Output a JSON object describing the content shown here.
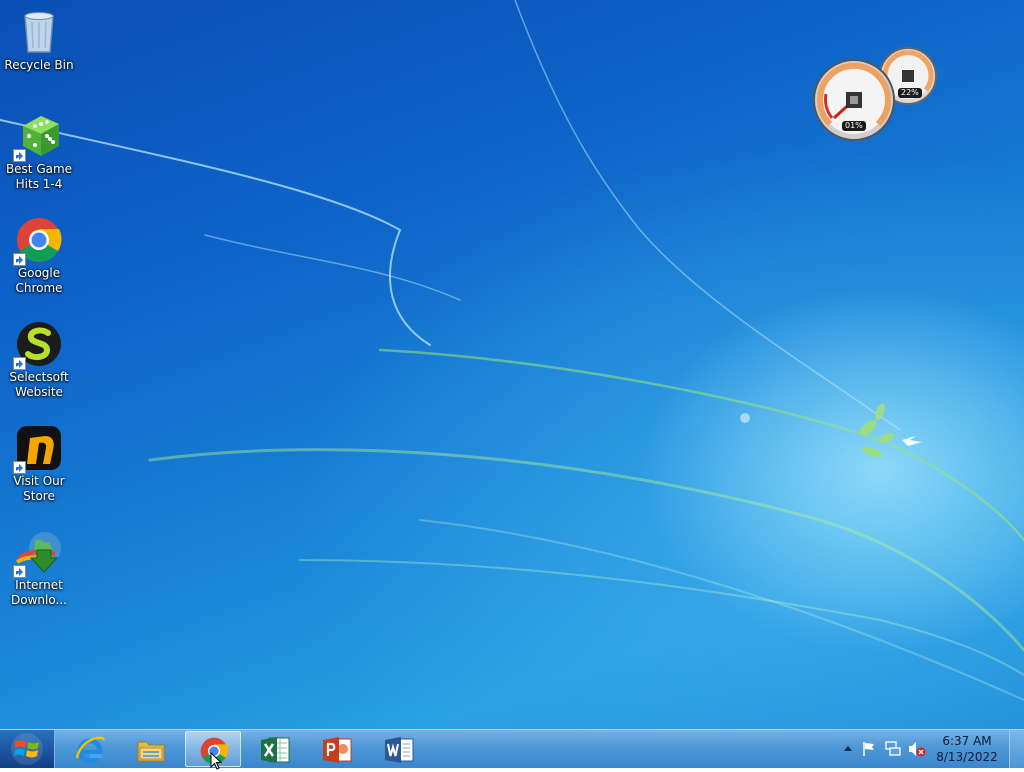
{
  "desktop": {
    "icons": [
      {
        "label": "Recycle Bin",
        "icon": "recycle-bin-icon"
      },
      {
        "label": "Best Game Hits 1-4",
        "icon": "dice-icon"
      },
      {
        "label": "Google Chrome",
        "icon": "chrome-icon"
      },
      {
        "label": "Selectsoft Website",
        "icon": "selectsoft-icon"
      },
      {
        "label": "Visit Our Store",
        "icon": "store-icon"
      },
      {
        "label": "Internet Downlo...",
        "icon": "internet-download-manager-icon"
      }
    ]
  },
  "gadget": {
    "cpu_readout": "01%",
    "memory_readout": "22%",
    "cpu_percent": 1,
    "memory_percent": 22
  },
  "taskbar": {
    "pinned": [
      {
        "name": "internet-explorer",
        "icon": "internet-explorer-icon"
      },
      {
        "name": "windows-explorer",
        "icon": "folder-icon"
      },
      {
        "name": "google-chrome",
        "icon": "chrome-icon",
        "active": true
      },
      {
        "name": "excel",
        "icon": "excel-icon"
      },
      {
        "name": "powerpoint",
        "icon": "powerpoint-icon"
      },
      {
        "name": "word",
        "icon": "word-icon"
      }
    ],
    "tray": {
      "time": "6:37 AM",
      "date": "8/13/2022",
      "icons": [
        "show-hidden-icons-arrow",
        "action-center-flag-icon",
        "network-icon",
        "volume-muted-icon"
      ]
    }
  },
  "colors": {
    "wallpaper": "#1a86d8",
    "taskbar": "#4e97d6",
    "excel": "#1e7145",
    "powerpoint": "#c43e1c",
    "word": "#2b5797"
  }
}
